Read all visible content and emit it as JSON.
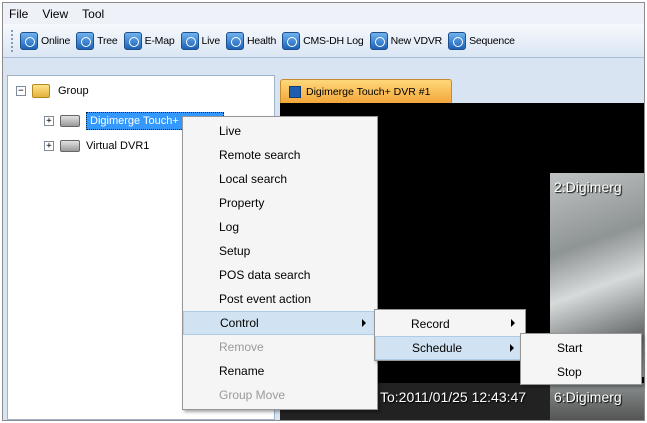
{
  "menubar": [
    "File",
    "View",
    "Tool"
  ],
  "toolbar": [
    {
      "label": "Online",
      "icon": "online-icon"
    },
    {
      "label": "Tree",
      "icon": "tree-icon"
    },
    {
      "label": "E-Map",
      "icon": "emap-icon"
    },
    {
      "label": "Live",
      "icon": "live-icon"
    },
    {
      "label": "Health",
      "icon": "health-icon"
    },
    {
      "label": "CMS-DH Log",
      "icon": "log-icon"
    },
    {
      "label": "New VDVR",
      "icon": "vdvr-icon"
    },
    {
      "label": "Sequence",
      "icon": "sequence-icon"
    }
  ],
  "tree": {
    "root": "Group",
    "nodes": [
      "Digimerge Touch+ DVR #1",
      "Virtual DVR1"
    ]
  },
  "tab": {
    "title": "Digimerge Touch+ DVR #1"
  },
  "video": {
    "cell2_label": "2:Digimerg",
    "timestamp": "To:2011/01/25 12:43:47",
    "cell6_label": "6:Digimerg"
  },
  "context_menu": [
    {
      "label": "Live",
      "state": "normal"
    },
    {
      "label": "Remote search",
      "state": "normal"
    },
    {
      "label": "Local search",
      "state": "normal"
    },
    {
      "label": "Property",
      "state": "normal"
    },
    {
      "label": "Log",
      "state": "normal"
    },
    {
      "label": "Setup",
      "state": "normal"
    },
    {
      "label": "POS data search",
      "state": "normal"
    },
    {
      "label": "Post event action",
      "state": "normal"
    },
    {
      "label": "Control",
      "state": "highlighted",
      "submenu": true
    },
    {
      "label": "Remove",
      "state": "disabled"
    },
    {
      "label": "Rename",
      "state": "normal"
    },
    {
      "label": "Group Move",
      "state": "disabled"
    }
  ],
  "control_submenu": [
    {
      "label": "Record",
      "submenu": true
    },
    {
      "label": "Schedule",
      "submenu": true,
      "state": "highlighted"
    }
  ],
  "schedule_submenu": [
    "Start",
    "Stop"
  ]
}
